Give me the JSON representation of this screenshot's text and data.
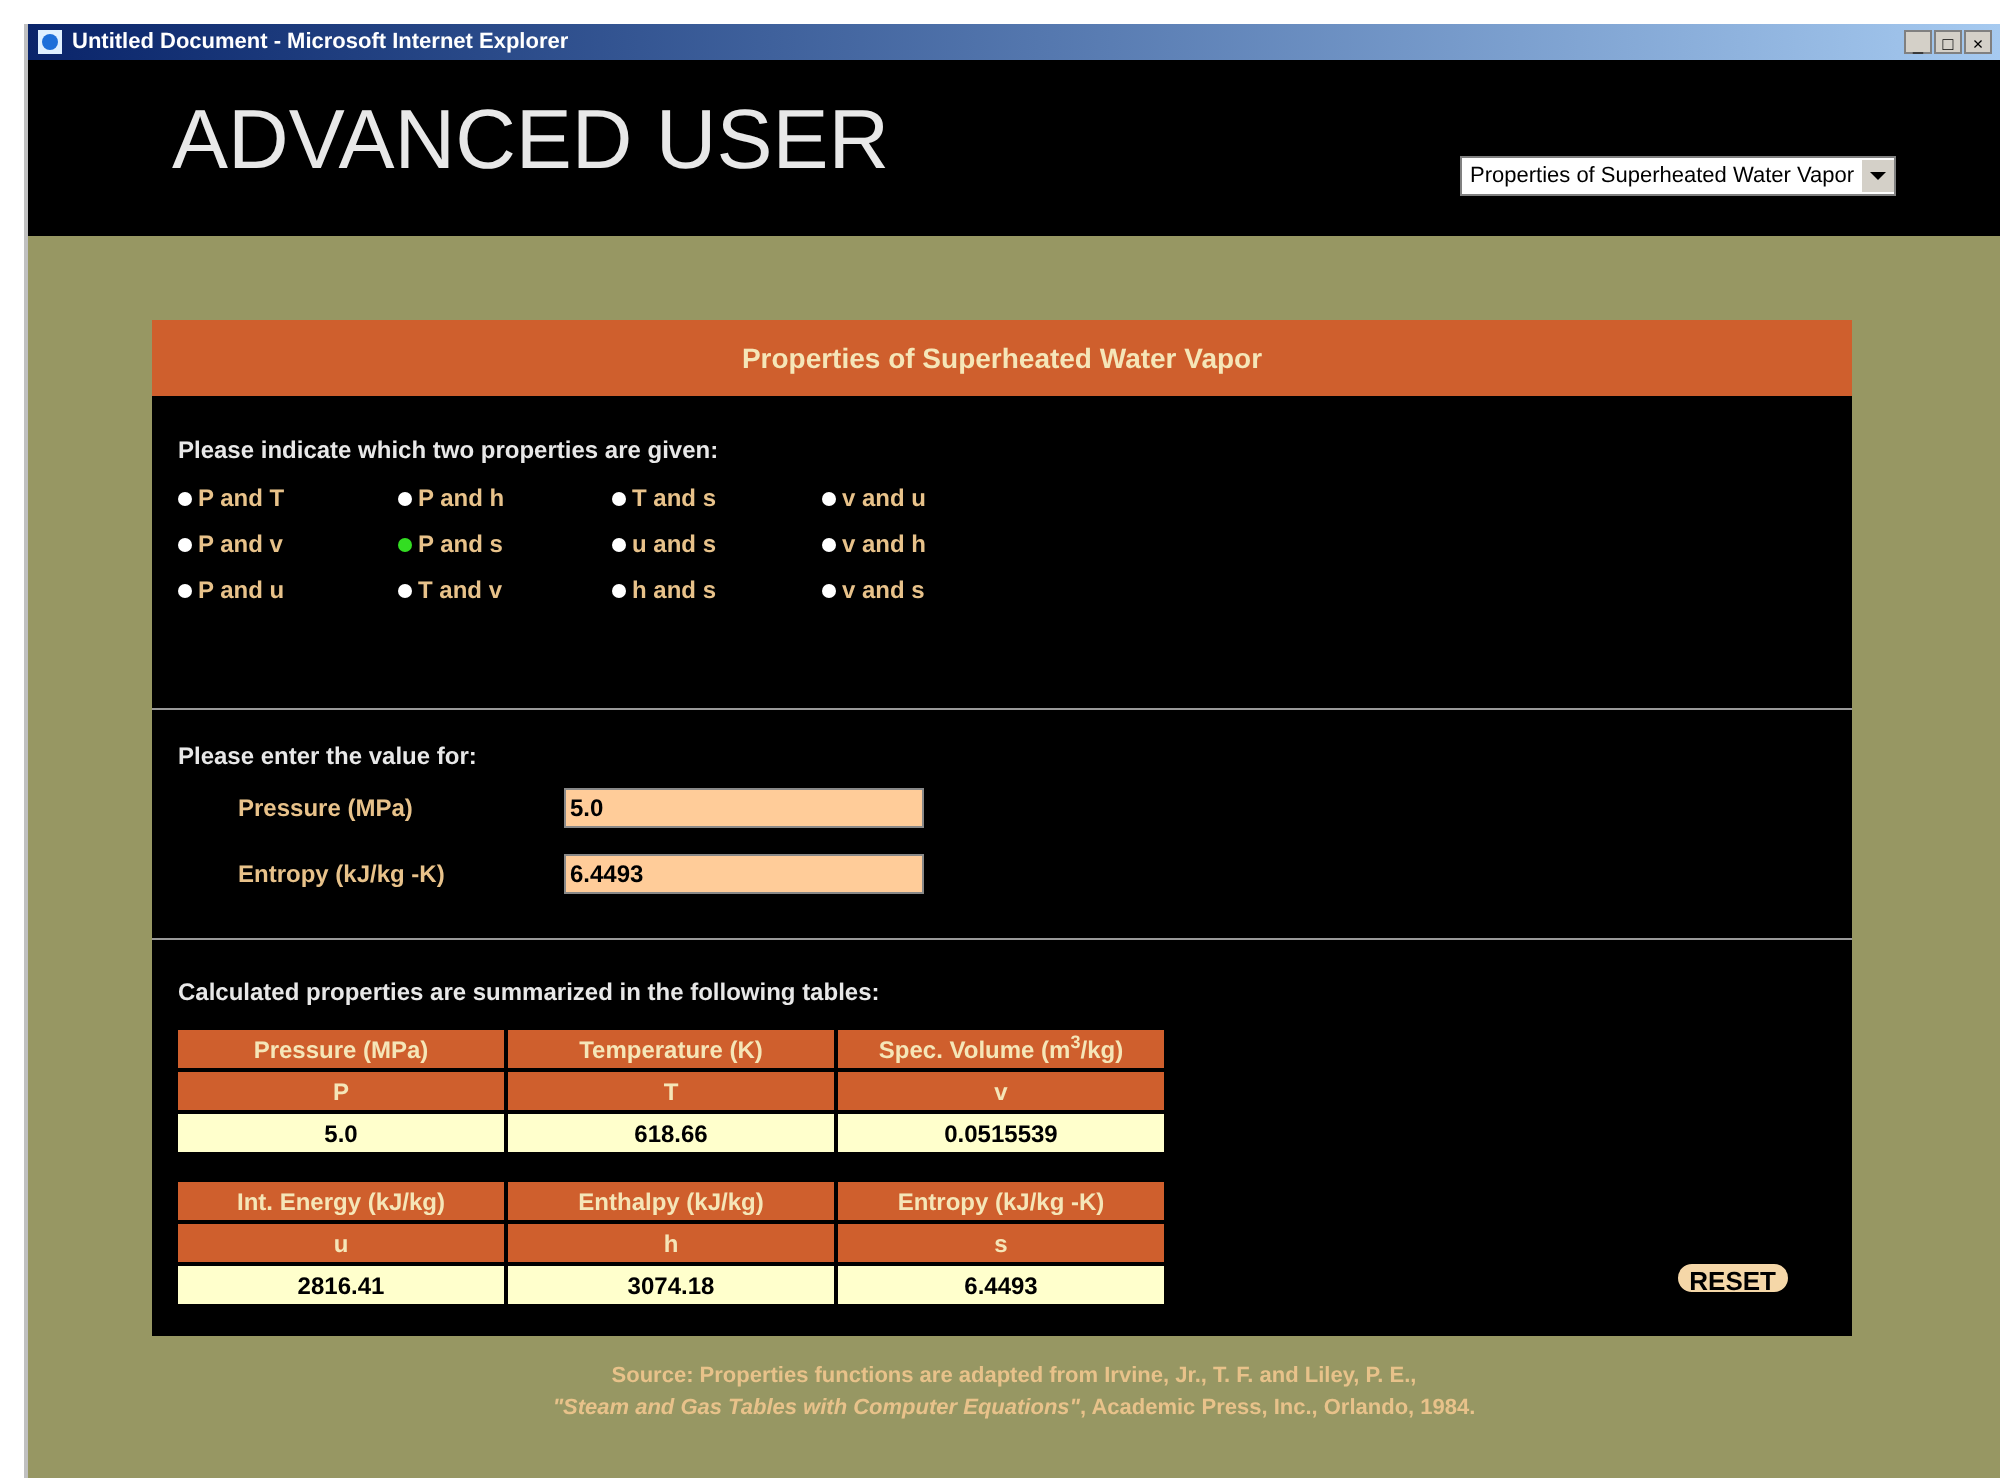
{
  "window": {
    "title": "Untitled Document - Microsoft Internet Explorer",
    "controls": [
      "_",
      "□",
      "×"
    ]
  },
  "header": {
    "title": "ADVANCED USER",
    "select": {
      "value": "Properties of Superheated Water Vapor"
    }
  },
  "panel": {
    "title": "Properties of Superheated Water Vapor"
  },
  "given": {
    "prompt": "Please indicate which two properties are given:",
    "options": [
      {
        "label": "P and T",
        "selected": false
      },
      {
        "label": "P and h",
        "selected": false
      },
      {
        "label": "T and s",
        "selected": false
      },
      {
        "label": "v and u",
        "selected": false
      },
      {
        "label": "P and v",
        "selected": false
      },
      {
        "label": "P and s",
        "selected": true
      },
      {
        "label": "u and s",
        "selected": false
      },
      {
        "label": "v and h",
        "selected": false
      },
      {
        "label": "P and u",
        "selected": false
      },
      {
        "label": "T and v",
        "selected": false
      },
      {
        "label": "h and s",
        "selected": false
      },
      {
        "label": "v and s",
        "selected": false
      }
    ]
  },
  "inputs": {
    "prompt": "Please enter the value for:",
    "fields": [
      {
        "label": "Pressure (MPa)",
        "value": "5.0"
      },
      {
        "label": "Entropy (kJ/kg -K)",
        "value": "6.4493"
      }
    ]
  },
  "results": {
    "prompt": "Calculated properties are summarized in the following tables:",
    "tables": [
      {
        "headers": [
          "Pressure (MPa)",
          "Temperature (K)",
          "Spec. Volume (m$^{3}$/kg)"
        ],
        "symbols": [
          "P",
          "T",
          "v"
        ],
        "values": [
          "5.0",
          "618.66",
          "0.0515539"
        ]
      },
      {
        "headers": [
          "Int. Energy (kJ/kg)",
          "Enthalpy (kJ/kg)",
          "Entropy (kJ/kg -K)"
        ],
        "symbols": [
          "u",
          "h",
          "s"
        ],
        "values": [
          "2816.41",
          "3074.18",
          "6.4493"
        ]
      }
    ]
  },
  "reset_button": {
    "label": "RESET"
  },
  "source": [
    "Source: Properties functions are adapted from Irvine, Jr., T. F. and Liley, P. E.,",
    "*\"Steam and Gas Tables with Computer Equations\"*, Academic Press, Inc., Orlando, 1984."
  ]
}
